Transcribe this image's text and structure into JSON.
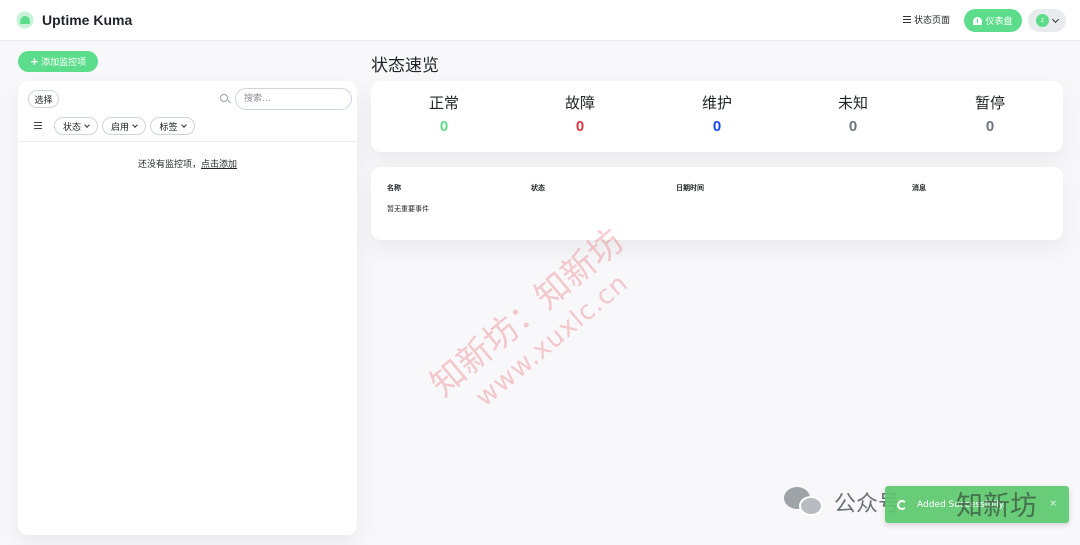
{
  "header": {
    "app_title": "Uptime Kuma",
    "status_page_label": "状态页面",
    "dashboard_label": "仪表盘",
    "avatar_letter": "z",
    "logo_icon": "uptime-kuma-logo",
    "accent_color": "#5cdd8b"
  },
  "sidebar": {
    "add_monitor_label": "添加监控项",
    "select_label": "选择",
    "search_placeholder": "搜索...",
    "filters": [
      {
        "label": "状态"
      },
      {
        "label": "启用"
      },
      {
        "label": "标签"
      }
    ],
    "empty_text": "还没有监控项，",
    "empty_link": "点击添加"
  },
  "overview": {
    "title": "状态速览",
    "stats": [
      {
        "label": "正常",
        "value": "0",
        "color": "#5cdd8b"
      },
      {
        "label": "故障",
        "value": "0",
        "color": "#dc3545"
      },
      {
        "label": "维护",
        "value": "0",
        "color": "#1747f5"
      },
      {
        "label": "未知",
        "value": "0",
        "color": "#6c757d"
      },
      {
        "label": "暂停",
        "value": "0",
        "color": "#6c757d"
      }
    ]
  },
  "events": {
    "columns": [
      "名称",
      "状态",
      "日期时间",
      "消息"
    ],
    "empty_text": "暂无重要事件"
  },
  "watermark": {
    "line1": "知新坊：知新坊",
    "line2": "www.xuxlc.cn"
  },
  "footer": {
    "brand_text": "公众号",
    "brand_overlay": "知新坊"
  },
  "toast": {
    "message": "Added Successfully.",
    "close": "×"
  }
}
